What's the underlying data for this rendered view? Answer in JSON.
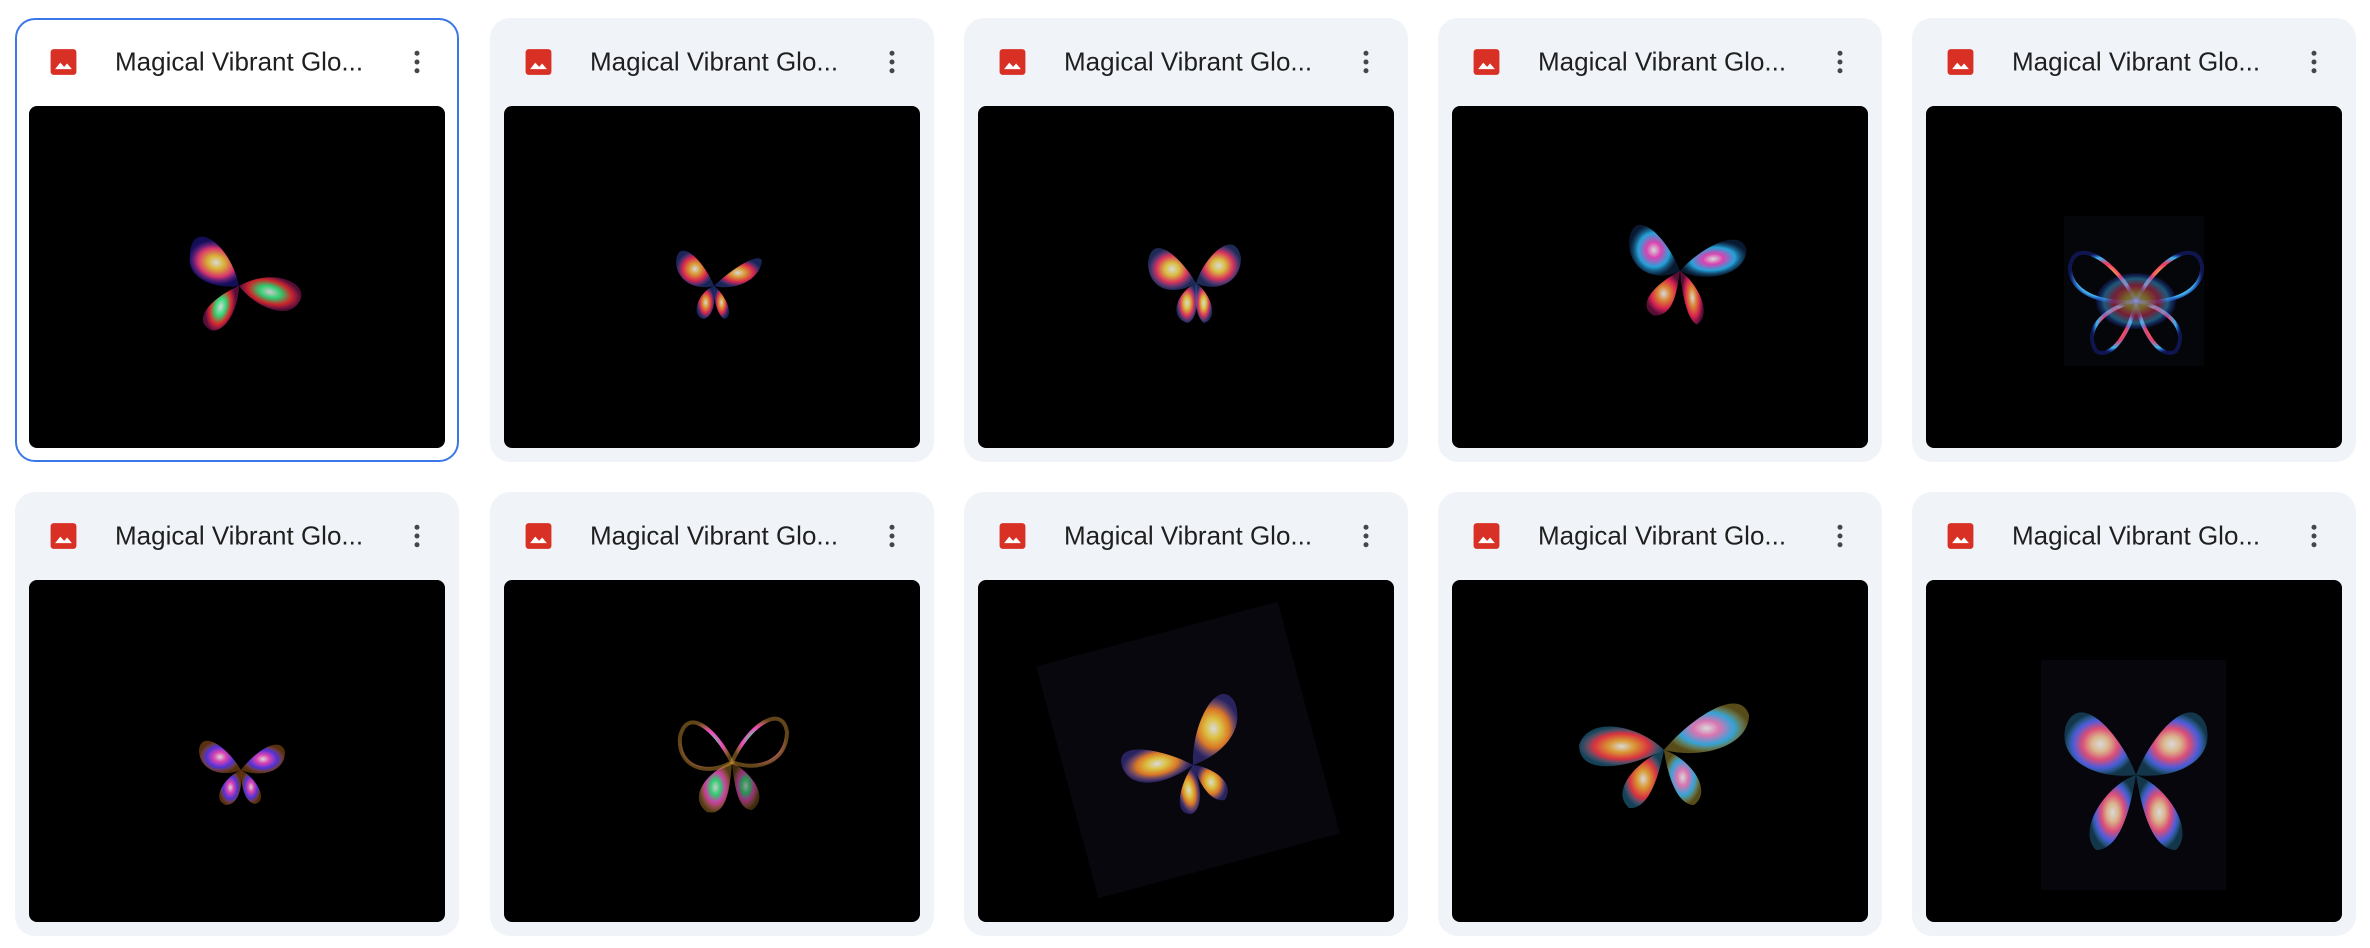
{
  "files": [
    {
      "title": "Magical Vibrant Glo...",
      "selected": true,
      "icon": "image-file-icon"
    },
    {
      "title": "Magical Vibrant Glo...",
      "selected": false,
      "icon": "image-file-icon"
    },
    {
      "title": "Magical Vibrant Glo...",
      "selected": false,
      "icon": "image-file-icon"
    },
    {
      "title": "Magical Vibrant Glo...",
      "selected": false,
      "icon": "image-file-icon"
    },
    {
      "title": "Magical Vibrant Glo...",
      "selected": false,
      "icon": "image-file-icon"
    },
    {
      "title": "Magical Vibrant Glo...",
      "selected": false,
      "icon": "image-file-icon"
    },
    {
      "title": "Magical Vibrant Glo...",
      "selected": false,
      "icon": "image-file-icon"
    },
    {
      "title": "Magical Vibrant Glo...",
      "selected": false,
      "icon": "image-file-icon"
    },
    {
      "title": "Magical Vibrant Glo...",
      "selected": false,
      "icon": "image-file-icon"
    },
    {
      "title": "Magical Vibrant Glo...",
      "selected": false,
      "icon": "image-file-icon"
    }
  ],
  "colors": {
    "card_background": "#f0f4f9",
    "selected_border": "#3b78e7",
    "image_icon_red": "#d93025",
    "thumbnail_background": "#000000"
  },
  "icons": {
    "file_type": "image-file-icon",
    "more_actions": "more-vert-icon"
  }
}
